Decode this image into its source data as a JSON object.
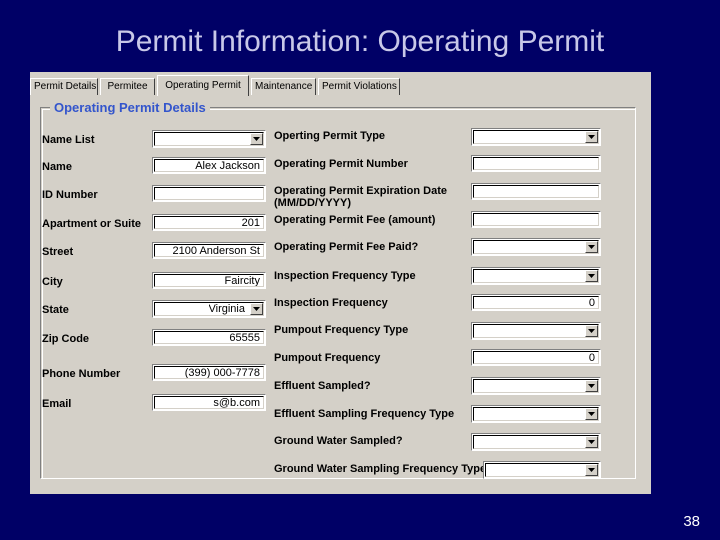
{
  "slide": {
    "title": "Permit Information: Operating Permit",
    "page_number": "38",
    "background_color": "#000066",
    "title_color": "#c8c8e8"
  },
  "window": {
    "chrome_color": "#d4d0c8",
    "tabs": [
      {
        "label": "Permit Details",
        "active": false
      },
      {
        "label": "Permitee",
        "active": false
      },
      {
        "label": "Operating Permit",
        "active": true
      },
      {
        "label": "Maintenance",
        "active": false
      },
      {
        "label": "Permit Violations",
        "active": false
      }
    ],
    "group_box": {
      "title": "Operating Permit Details",
      "title_color": "#3355cc"
    },
    "left_fields": [
      {
        "label": "Name List",
        "type": "combobox",
        "value": ""
      },
      {
        "label": "Name",
        "type": "textbox",
        "value": "Alex Jackson"
      },
      {
        "label": "ID Number",
        "type": "textbox",
        "value": ""
      },
      {
        "label": "Apartment or Suite",
        "type": "textbox",
        "value": "201"
      },
      {
        "label": "Street",
        "type": "textbox",
        "value": "2100 Anderson St"
      },
      {
        "label": "City",
        "type": "textbox",
        "value": "Faircity"
      },
      {
        "label": "State",
        "type": "combobox",
        "value": "Virginia"
      },
      {
        "label": "Zip Code",
        "type": "textbox",
        "value": "65555"
      },
      {
        "label": "Phone Number",
        "type": "textbox",
        "value": "(399) 000-7778"
      },
      {
        "label": "Email",
        "type": "textbox",
        "value": "s@b.com"
      }
    ],
    "right_fields": [
      {
        "label": "Operting Permit Type",
        "type": "combobox",
        "value": ""
      },
      {
        "label": "Operating Permit Number",
        "type": "textbox",
        "value": ""
      },
      {
        "label": "Operating Permit Expiration Date (MM/DD/YYYY)",
        "type": "textbox",
        "value": ""
      },
      {
        "label": "Operating Permit Fee (amount)",
        "type": "textbox",
        "value": ""
      },
      {
        "label": "Operating Permit Fee Paid?",
        "type": "combobox",
        "value": ""
      },
      {
        "label": "Inspection Frequency Type",
        "type": "combobox",
        "value": ""
      },
      {
        "label": "Inspection Frequency",
        "type": "textbox",
        "value": "0"
      },
      {
        "label": "Pumpout Frequency Type",
        "type": "combobox",
        "value": ""
      },
      {
        "label": "Pumpout Frequency",
        "type": "textbox",
        "value": "0"
      },
      {
        "label": "Effluent Sampled?",
        "type": "combobox",
        "value": ""
      },
      {
        "label": "Effluent Sampling Frequency Type",
        "type": "combobox",
        "value": ""
      },
      {
        "label": "Ground Water Sampled?",
        "type": "combobox",
        "value": ""
      },
      {
        "label": "Ground Water Sampling Frequency Type",
        "type": "combobox",
        "value": ""
      }
    ]
  }
}
